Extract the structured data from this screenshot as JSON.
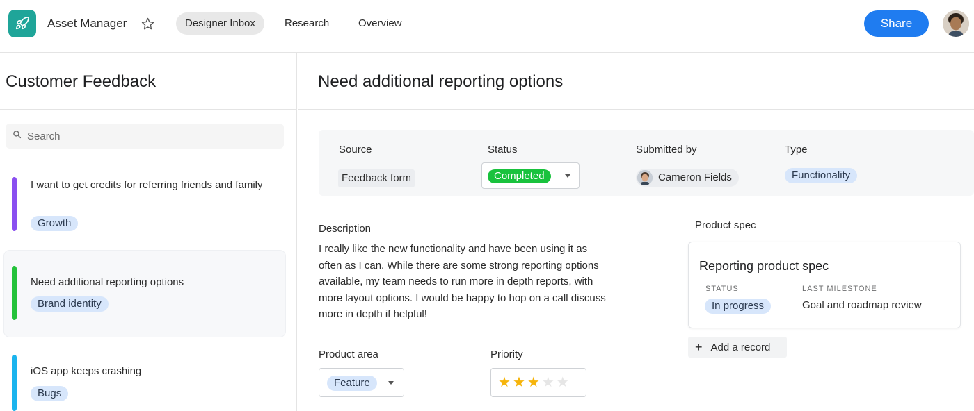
{
  "header": {
    "app_name": "Asset Manager",
    "tabs": [
      {
        "label": "Designer Inbox",
        "active": true
      },
      {
        "label": "Research",
        "active": false
      },
      {
        "label": "Overview",
        "active": false
      }
    ],
    "share_label": "Share",
    "colors": {
      "logo_bg": "#1fa599",
      "share_bg": "#1f7cf0"
    }
  },
  "left": {
    "title": "Customer Feedback",
    "search_placeholder": "Search",
    "items": [
      {
        "text": "I want to get credits for referring friends and family",
        "tag": "Growth",
        "color": "#8a4ff0",
        "selected": false
      },
      {
        "text": "Need additional reporting options",
        "tag": "Brand identity",
        "color": "#24c23a",
        "selected": true
      },
      {
        "text": "iOS app keeps crashing",
        "tag": "Bugs",
        "color": "#1bb4ee",
        "selected": false
      }
    ]
  },
  "detail": {
    "title": "Need additional reporting options",
    "meta": {
      "source_label": "Source",
      "source_value": "Feedback form",
      "status_label": "Status",
      "status_value": "Completed",
      "submitted_label": "Submitted by",
      "submitted_value": "Cameron Fields",
      "type_label": "Type",
      "type_value": "Functionality"
    },
    "description_label": "Description",
    "description": "I really like the new functionality and have been using it as often as I can. While there are some strong reporting options available, my team needs to run more in depth reports, with more layout options. I would be happy to hop on a call discuss more in depth if helpful!",
    "product_area_label": "Product area",
    "product_area_value": "Feature",
    "priority_label": "Priority",
    "priority_rating": 3,
    "priority_max": 5,
    "product_spec_label": "Product spec",
    "spec": {
      "title": "Reporting product spec",
      "status_label": "STATUS",
      "status_value": "In progress",
      "milestone_label": "LAST MILESTONE",
      "milestone_value": "Goal and roadmap review"
    },
    "add_record_label": "Add a record"
  }
}
